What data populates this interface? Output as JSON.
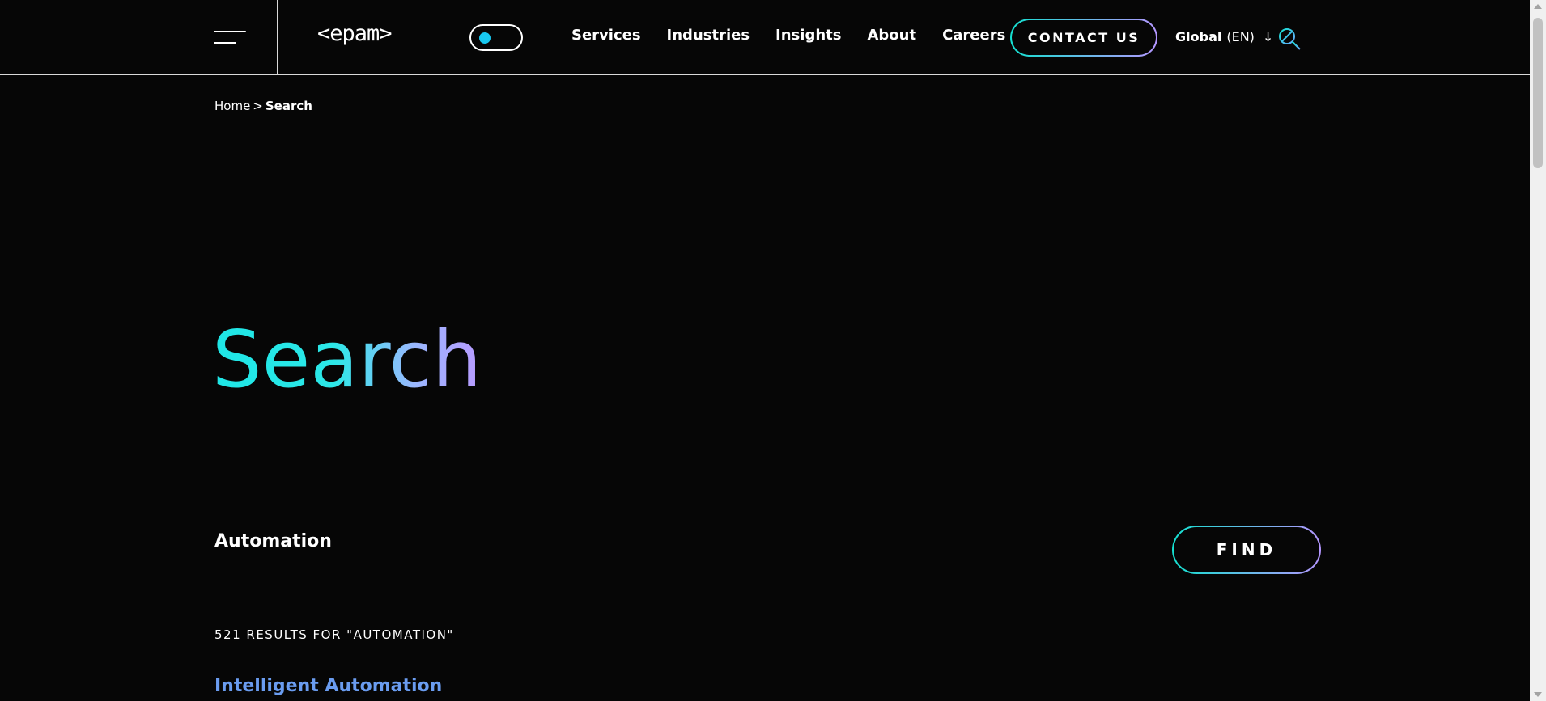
{
  "header": {
    "logo_text": "<epam>",
    "nav": [
      "Services",
      "Industries",
      "Insights",
      "About",
      "Careers"
    ],
    "contact_label": "CONTACT US",
    "lang_region": "Global",
    "lang_code": "(EN)",
    "lang_arrow": "↓",
    "toggle_knob_color": "#18c8f0"
  },
  "breadcrumb": {
    "home": "Home",
    "separator": ">",
    "current": "Search"
  },
  "page_title": "Search",
  "search": {
    "value": "Automation",
    "find_label": "FIND"
  },
  "results": {
    "count_text": "521 RESULTS FOR \"AUTOMATION\"",
    "first_title": "Intelligent Automation",
    "link_color": "#6a9cf0"
  },
  "colors": {
    "background": "#060606",
    "gradient_start": "#14e0d0",
    "gradient_end": "#b496ff"
  }
}
